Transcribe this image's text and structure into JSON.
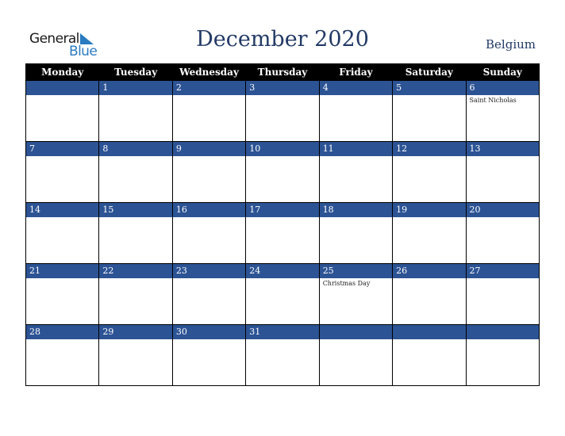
{
  "logo": {
    "line1": "General",
    "line2": "Blue"
  },
  "title": "December 2020",
  "country": "Belgium",
  "colors": {
    "header_bg": "#000000",
    "band_bg": "#2c5394",
    "title": "#233a66",
    "logo_blue": "#2b7bc0"
  },
  "weekdays": [
    "Monday",
    "Tuesday",
    "Wednesday",
    "Thursday",
    "Friday",
    "Saturday",
    "Sunday"
  ],
  "weeks": [
    [
      {
        "day": "",
        "holiday": ""
      },
      {
        "day": "1",
        "holiday": ""
      },
      {
        "day": "2",
        "holiday": ""
      },
      {
        "day": "3",
        "holiday": ""
      },
      {
        "day": "4",
        "holiday": ""
      },
      {
        "day": "5",
        "holiday": ""
      },
      {
        "day": "6",
        "holiday": "Saint Nicholas"
      }
    ],
    [
      {
        "day": "7",
        "holiday": ""
      },
      {
        "day": "8",
        "holiday": ""
      },
      {
        "day": "9",
        "holiday": ""
      },
      {
        "day": "10",
        "holiday": ""
      },
      {
        "day": "11",
        "holiday": ""
      },
      {
        "day": "12",
        "holiday": ""
      },
      {
        "day": "13",
        "holiday": ""
      }
    ],
    [
      {
        "day": "14",
        "holiday": ""
      },
      {
        "day": "15",
        "holiday": ""
      },
      {
        "day": "16",
        "holiday": ""
      },
      {
        "day": "17",
        "holiday": ""
      },
      {
        "day": "18",
        "holiday": ""
      },
      {
        "day": "19",
        "holiday": ""
      },
      {
        "day": "20",
        "holiday": ""
      }
    ],
    [
      {
        "day": "21",
        "holiday": ""
      },
      {
        "day": "22",
        "holiday": ""
      },
      {
        "day": "23",
        "holiday": ""
      },
      {
        "day": "24",
        "holiday": ""
      },
      {
        "day": "25",
        "holiday": "Christmas Day"
      },
      {
        "day": "26",
        "holiday": ""
      },
      {
        "day": "27",
        "holiday": ""
      }
    ],
    [
      {
        "day": "28",
        "holiday": ""
      },
      {
        "day": "29",
        "holiday": ""
      },
      {
        "day": "30",
        "holiday": ""
      },
      {
        "day": "31",
        "holiday": ""
      },
      {
        "day": "",
        "holiday": ""
      },
      {
        "day": "",
        "holiday": ""
      },
      {
        "day": "",
        "holiday": ""
      }
    ]
  ]
}
